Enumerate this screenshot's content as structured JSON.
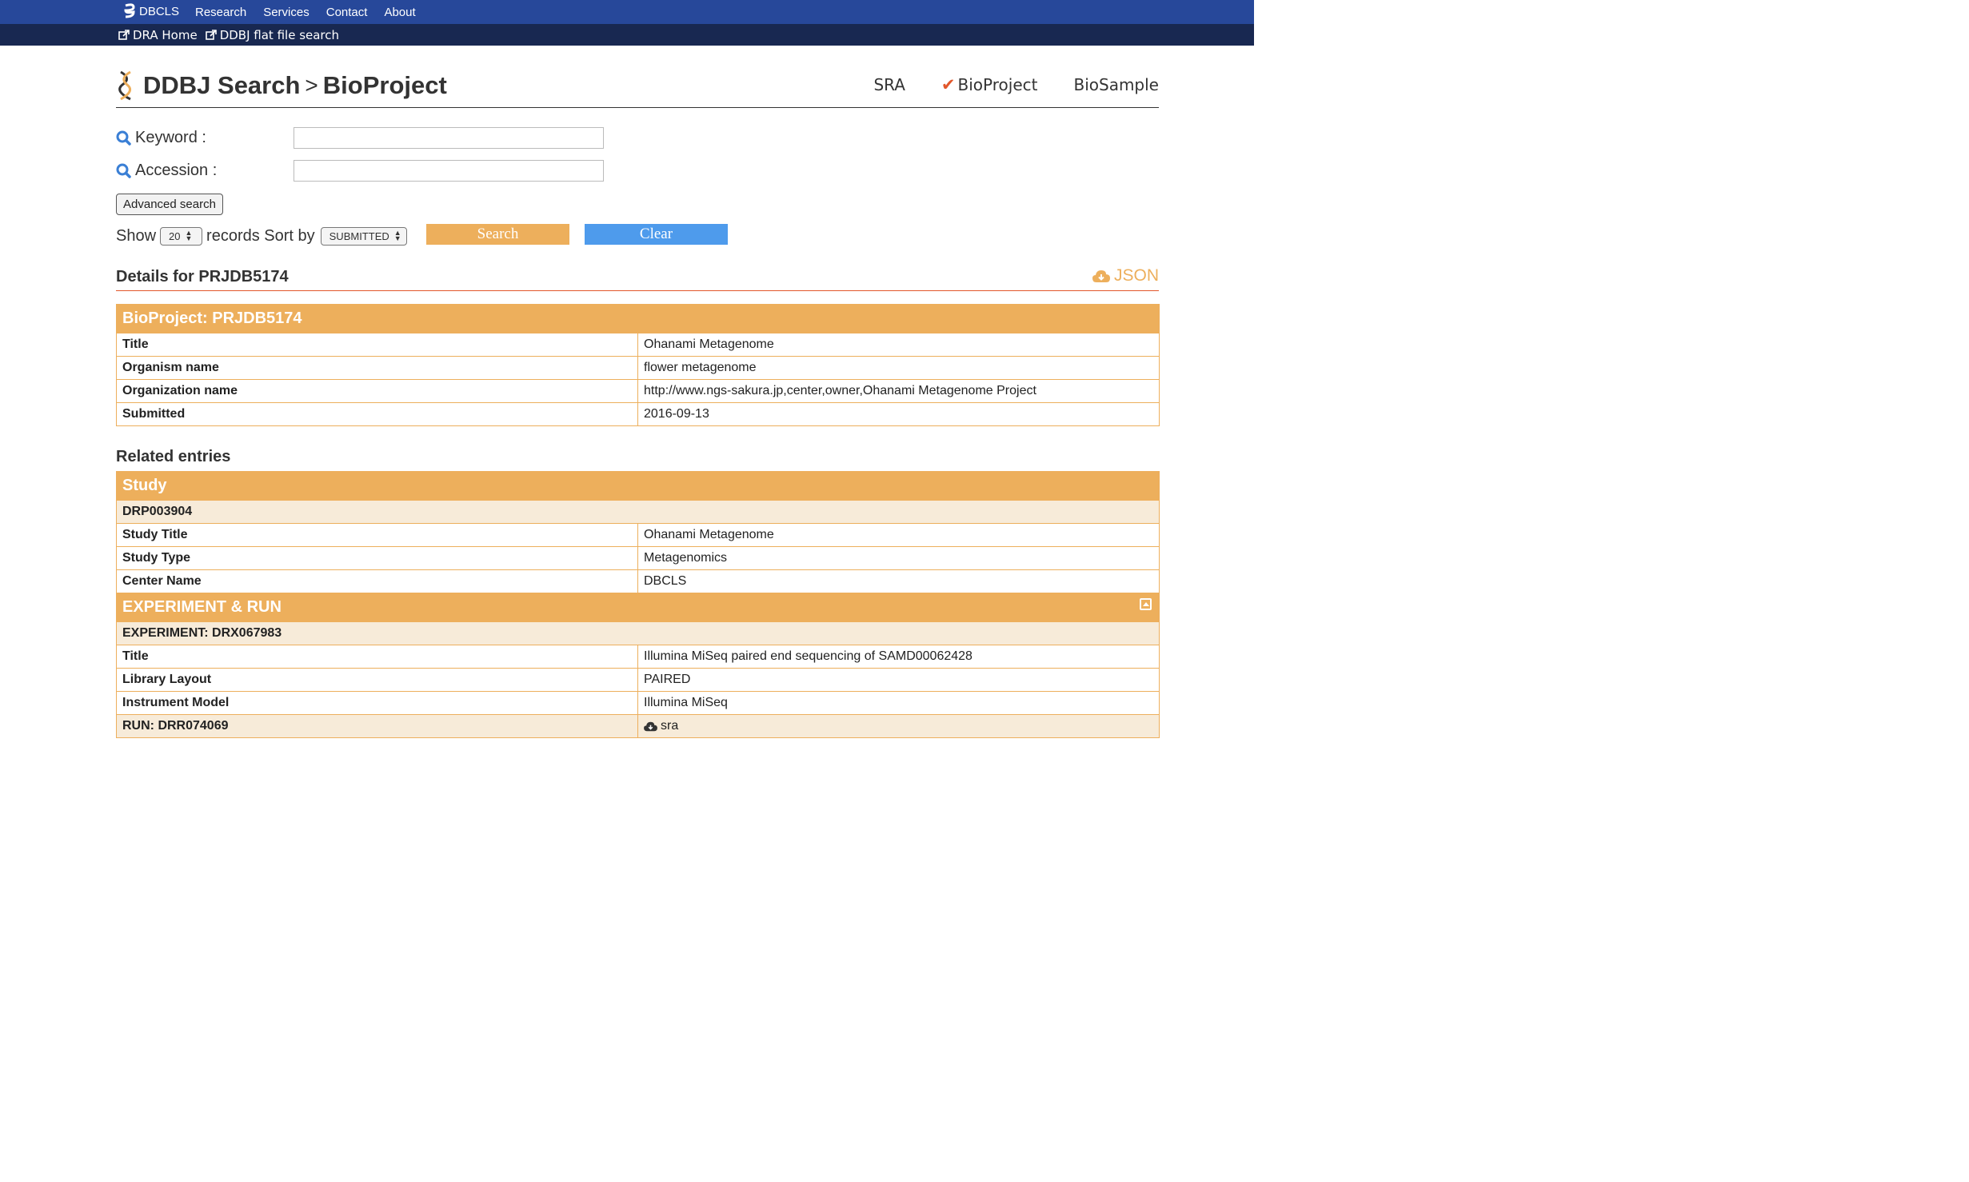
{
  "topnav": {
    "logo": "DBCLS",
    "items": [
      "Research",
      "Services",
      "Contact",
      "About"
    ]
  },
  "subnav": {
    "items": [
      "DRA Home",
      "DDBJ flat file search"
    ]
  },
  "header": {
    "site": "DDBJ Search",
    "separator": ">",
    "section": "BioProject",
    "tabs": [
      "SRA",
      "BioProject",
      "BioSample"
    ],
    "active_tab": "BioProject"
  },
  "search": {
    "keyword_label": "Keyword :",
    "keyword_value": "",
    "accession_label": "Accession :",
    "accession_value": "",
    "advanced_label": "Advanced search",
    "show_label": "Show",
    "show_value": "20",
    "records_label": "records Sort by",
    "sort_value": "SUBMITTED",
    "search_button": "Search",
    "clear_button": "Clear"
  },
  "details": {
    "heading": "Details for PRJDB5174",
    "json_link": "JSON",
    "bioproject_caption": "BioProject: PRJDB5174",
    "rows": [
      {
        "key": "Title",
        "value": "Ohanami Metagenome"
      },
      {
        "key": "Organism name",
        "value": "flower metagenome"
      },
      {
        "key": "Organization name",
        "value": "http://www.ngs-sakura.jp,center,owner,Ohanami Metagenome Project"
      },
      {
        "key": "Submitted",
        "value": "2016-09-13"
      }
    ]
  },
  "related": {
    "heading": "Related entries",
    "study_caption": "Study",
    "study_id": "DRP003904",
    "study_rows": [
      {
        "key": "Study Title",
        "value": "Ohanami Metagenome"
      },
      {
        "key": "Study Type",
        "value": "Metagenomics"
      },
      {
        "key": "Center Name",
        "value": "DBCLS"
      }
    ],
    "exp_caption": "EXPERIMENT & RUN",
    "experiment_id": "EXPERIMENT: DRX067983",
    "exp_rows": [
      {
        "key": "Title",
        "value": "Illumina MiSeq paired end sequencing of SAMD00062428"
      },
      {
        "key": "Library Layout",
        "value": "PAIRED"
      },
      {
        "key": "Instrument Model",
        "value": "Illumina MiSeq"
      }
    ],
    "run_id": "RUN: DRR074069",
    "run_link": "sra"
  },
  "colors": {
    "topbar": "#27489a",
    "subbar": "#182851",
    "accent_orange": "#edaf5c",
    "accent_blue": "#4e9bec",
    "check_red": "#e2572b",
    "search_icon": "#3a7fd5"
  },
  "icons": [
    "dbcls-logo-icon",
    "external-link-icon",
    "ddbj-logo-icon",
    "check-icon",
    "search-icon",
    "cloud-download-icon",
    "collapse-icon"
  ]
}
